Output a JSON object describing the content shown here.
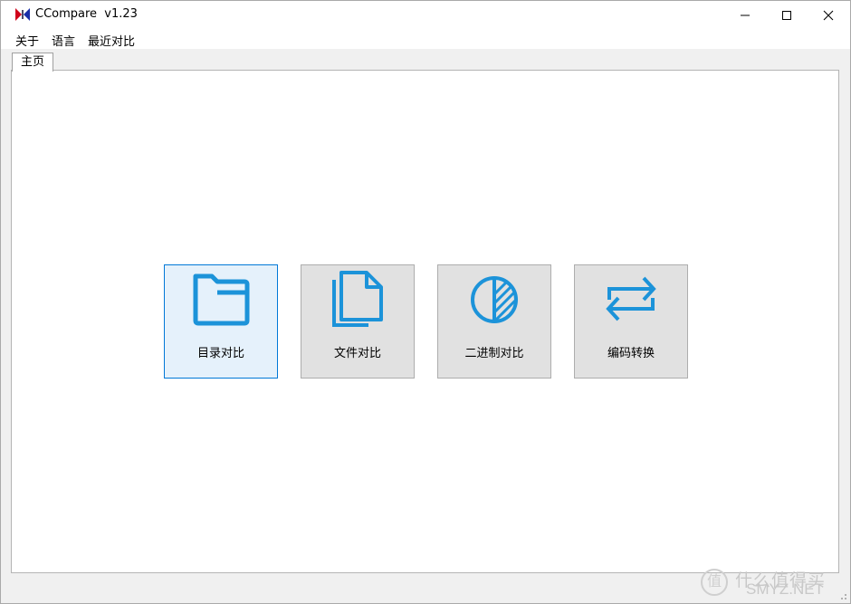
{
  "window": {
    "title": "CCompare  v1.23",
    "controls": {
      "minimize": "minimize",
      "maximize": "maximize",
      "close": "close"
    }
  },
  "menu": {
    "items": [
      "关于",
      "语言",
      "最近对比"
    ]
  },
  "tabs": [
    {
      "label": "主页",
      "active": true
    }
  ],
  "tiles": [
    {
      "label": "目录对比",
      "icon": "folder-icon",
      "selected": true
    },
    {
      "label": "文件对比",
      "icon": "documents-icon",
      "selected": false
    },
    {
      "label": "二进制对比",
      "icon": "half-circle-hatched-icon",
      "selected": false
    },
    {
      "label": "编码转换",
      "icon": "swap-arrows-icon",
      "selected": false
    }
  ],
  "watermark": {
    "badge": "值",
    "text_cn": "什么值得买",
    "text_en": "SMYZ.NET"
  },
  "colors": {
    "accent": "#1c93d9",
    "selected_bg": "#e5f1fb",
    "selected_border": "#0078d7",
    "tile_bg": "#e1e1e1"
  }
}
